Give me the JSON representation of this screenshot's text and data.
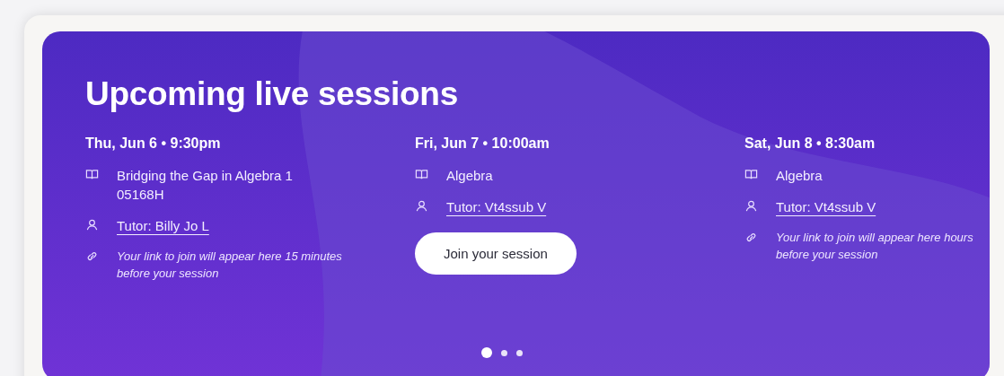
{
  "title": "Upcoming live sessions",
  "sessions": [
    {
      "date": "Thu, Jun 6 • 9:30pm",
      "course": "Bridging the Gap in Algebra 1 05168H",
      "tutor": "Tutor: Billy Jo L",
      "action": {
        "kind": "note",
        "text": "Your link to join will appear here 15 minutes before your session"
      }
    },
    {
      "date": "Fri, Jun 7 • 10:00am",
      "course": "Algebra",
      "tutor": "Tutor: Vt4ssub V",
      "action": {
        "kind": "button",
        "text": "Join your session"
      }
    },
    {
      "date": "Sat, Jun 8 • 8:30am",
      "course": "Algebra",
      "tutor": "Tutor: Vt4ssub V",
      "action": {
        "kind": "note",
        "text": "Your link to join will appear here hours before your session"
      }
    }
  ],
  "pager": [
    {
      "selected": true
    },
    {
      "selected": false
    },
    {
      "selected": false
    }
  ]
}
